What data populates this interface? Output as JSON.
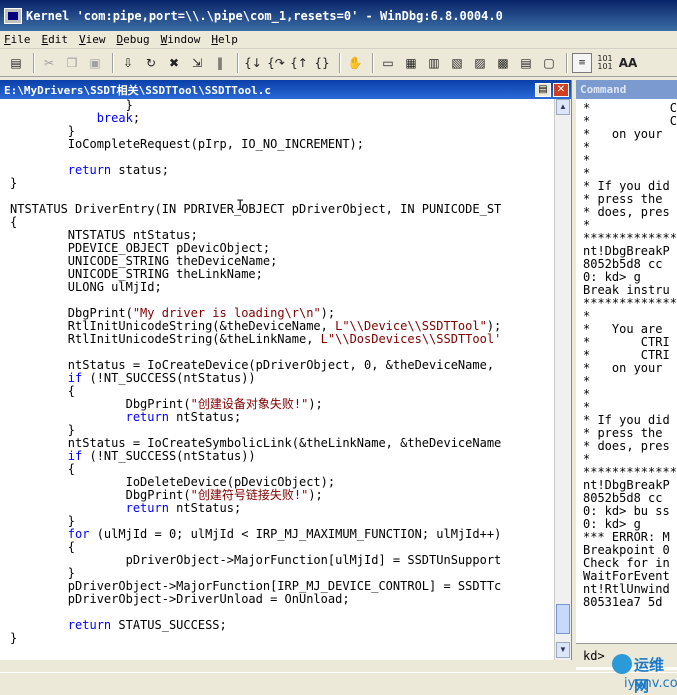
{
  "window": {
    "title": "Kernel 'com:pipe,port=\\\\.\\pipe\\com_1,resets=0' - WinDbg:6.8.0004.0"
  },
  "menu": [
    "File",
    "Edit",
    "View",
    "Debug",
    "Window",
    "Help"
  ],
  "toolbar": {
    "icons": [
      "open-icon",
      "cut-icon",
      "copy-icon",
      "paste-icon",
      "go-icon",
      "restart-icon",
      "stop-debugging-icon",
      "detach-icon",
      "break-icon",
      "step-into-icon",
      "step-over-icon",
      "step-out-icon",
      "run-to-cursor-icon",
      "hand-icon",
      "command-icon",
      "watch-icon",
      "locals-icon",
      "registers-icon",
      "memory-icon",
      "call-stack-icon",
      "disassembly-icon",
      "scratch-pad-icon",
      "source-mode-icon",
      "hex-icon",
      "font-icon"
    ],
    "hex_label": "101\n101",
    "font_label": "AA"
  },
  "source_window": {
    "title": "E:\\MyDrivers\\SSDT相关\\SSDTTool\\SSDTTool.c",
    "lines": [
      [
        {
          "t": "                }"
        }
      ],
      [
        {
          "t": "            "
        },
        {
          "t": "break",
          "k": 1
        },
        {
          "t": ";"
        }
      ],
      [
        {
          "t": "        }"
        }
      ],
      [
        {
          "t": "        IoCompleteRequest(pIrp, IO_NO_INCREMENT);"
        }
      ],
      [
        {
          "t": ""
        }
      ],
      [
        {
          "t": "        "
        },
        {
          "t": "return",
          "k": 1
        },
        {
          "t": " status;"
        }
      ],
      [
        {
          "t": "}"
        }
      ],
      [
        {
          "t": ""
        }
      ],
      [
        {
          "t": "NTSTATUS DriverEntry(IN PDRIVER_OBJECT pDriverObject, IN PUNICODE_ST"
        }
      ],
      [
        {
          "t": "{"
        }
      ],
      [
        {
          "t": "        NTSTATUS ntStatus;"
        }
      ],
      [
        {
          "t": "        PDEVICE_OBJECT pDevicObject;"
        }
      ],
      [
        {
          "t": "        UNICODE_STRING theDeviceName;"
        }
      ],
      [
        {
          "t": "        UNICODE_STRING theLinkName;"
        }
      ],
      [
        {
          "t": "        ULONG ulMjId;"
        }
      ],
      [
        {
          "t": ""
        }
      ],
      [
        {
          "t": "        DbgPrint("
        },
        {
          "t": "\"My driver is loading\\r\\n\"",
          "s": 1
        },
        {
          "t": ");"
        }
      ],
      [
        {
          "t": "        RtlInitUnicodeString(&theDeviceName, "
        },
        {
          "t": "L\"\\\\Device\\\\SSDTTool\"",
          "s": 1
        },
        {
          "t": ");"
        }
      ],
      [
        {
          "t": "        RtlInitUnicodeString(&theLinkName, "
        },
        {
          "t": "L\"\\\\DosDevices\\\\SSDTTool'",
          "s": 1
        }
      ],
      [
        {
          "t": ""
        }
      ],
      [
        {
          "t": "        ntStatus = IoCreateDevice(pDriverObject, 0, &theDeviceName,"
        }
      ],
      [
        {
          "t": "        "
        },
        {
          "t": "if",
          "k": 1
        },
        {
          "t": " (!NT_SUCCESS(ntStatus))"
        }
      ],
      [
        {
          "t": "        {"
        }
      ],
      [
        {
          "t": "                DbgPrint("
        },
        {
          "t": "\"创建设备对象失败!\"",
          "s": 1
        },
        {
          "t": ");"
        }
      ],
      [
        {
          "t": "                "
        },
        {
          "t": "return",
          "k": 1
        },
        {
          "t": " ntStatus;"
        }
      ],
      [
        {
          "t": "        }"
        }
      ],
      [
        {
          "t": "        ntStatus = IoCreateSymbolicLink(&theLinkName, &theDeviceName"
        }
      ],
      [
        {
          "t": "        "
        },
        {
          "t": "if",
          "k": 1
        },
        {
          "t": " (!NT_SUCCESS(ntStatus))"
        }
      ],
      [
        {
          "t": "        {"
        }
      ],
      [
        {
          "t": "                IoDeleteDevice(pDevicObject);"
        }
      ],
      [
        {
          "t": "                DbgPrint("
        },
        {
          "t": "\"创建符号链接失败!\"",
          "s": 1
        },
        {
          "t": ");"
        }
      ],
      [
        {
          "t": "                "
        },
        {
          "t": "return",
          "k": 1
        },
        {
          "t": " ntStatus;"
        }
      ],
      [
        {
          "t": "        }"
        }
      ],
      [
        {
          "t": "        "
        },
        {
          "t": "for",
          "k": 1
        },
        {
          "t": " (ulMjId = 0; ulMjId < IRP_MJ_MAXIMUM_FUNCTION; ulMjId++)"
        }
      ],
      [
        {
          "t": "        {"
        }
      ],
      [
        {
          "t": "                pDriverObject->MajorFunction[ulMjId] = SSDTUnSupport"
        }
      ],
      [
        {
          "t": "        }"
        }
      ],
      [
        {
          "t": "        pDriverObject->MajorFunction[IRP_MJ_DEVICE_CONTROL] = SSDTTc"
        }
      ],
      [
        {
          "t": "        pDriverObject->DriverUnload = OnUnload;"
        }
      ],
      [
        {
          "t": ""
        }
      ],
      [
        {
          "t": "        "
        },
        {
          "t": "return",
          "k": 1
        },
        {
          "t": " STATUS_SUCCESS;"
        }
      ],
      [
        {
          "t": "}"
        }
      ]
    ]
  },
  "command_window": {
    "title": "Command",
    "lines": [
      "*           CTRI",
      "*           CTRI",
      "*   on your",
      "*",
      "*",
      "*",
      "* If you did",
      "* press the",
      "* does, pres",
      "*",
      "*************",
      "nt!DbgBreakP",
      "8052b5d8 cc",
      "0: kd> g",
      "Break instru",
      "*************",
      "*",
      "*   You are",
      "*       CTRI",
      "*       CTRI",
      "*   on your",
      "*",
      "*",
      "*",
      "* If you did",
      "* press the",
      "* does, pres",
      "*",
      "*************",
      "nt!DbgBreakP",
      "8052b5d8 cc",
      "0: kd> bu ss",
      "0: kd> g",
      "*** ERROR: M",
      "Breakpoint 0",
      "Check for in",
      "WaitForEvent",
      "nt!RtlUnwind",
      "80531ea7 5d"
    ],
    "prompt": "kd>"
  },
  "watermark": {
    "cn": "运维网",
    "en": "iyunv.com"
  }
}
